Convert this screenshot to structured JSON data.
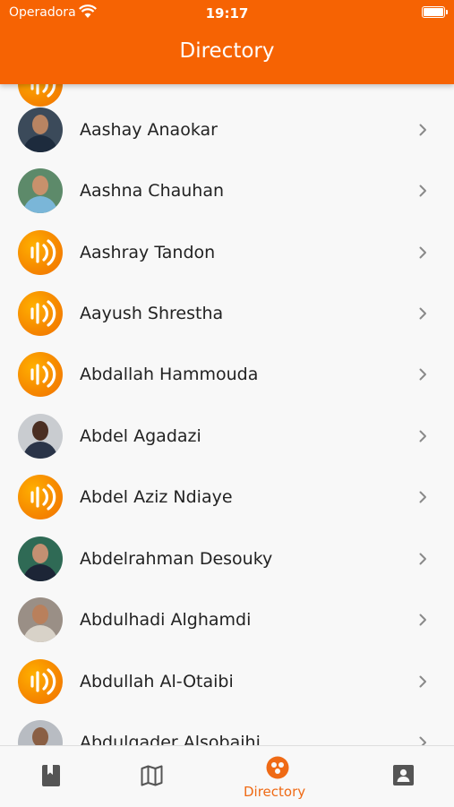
{
  "status_bar": {
    "carrier": "Operadora",
    "time": "19:17"
  },
  "header": {
    "title": "Directory"
  },
  "contacts": [
    {
      "name": "",
      "avatar": "logo-icon"
    },
    {
      "name": "Aashay Anaokar",
      "avatar": "photo"
    },
    {
      "name": "Aashna Chauhan",
      "avatar": "photo"
    },
    {
      "name": "Aashray Tandon",
      "avatar": "logo-icon"
    },
    {
      "name": "Aayush Shrestha",
      "avatar": "logo-icon"
    },
    {
      "name": "Abdallah Hammouda",
      "avatar": "logo-icon"
    },
    {
      "name": "Abdel Agadazi",
      "avatar": "photo"
    },
    {
      "name": "Abdel Aziz Ndiaye",
      "avatar": "logo-icon"
    },
    {
      "name": "Abdelrahman Desouky",
      "avatar": "photo"
    },
    {
      "name": "Abdulhadi Alghamdi",
      "avatar": "photo"
    },
    {
      "name": "Abdullah Al-Otaibi",
      "avatar": "logo-icon"
    },
    {
      "name": "Abdulqader Alsobaihi",
      "avatar": "photo"
    }
  ],
  "tabs": [
    {
      "icon": "bookmark-book-icon",
      "label": ""
    },
    {
      "icon": "map-icon",
      "label": ""
    },
    {
      "icon": "directory-icon",
      "label": "Directory",
      "active": true
    },
    {
      "icon": "profile-card-icon",
      "label": ""
    }
  ],
  "colors": {
    "accent": "#f66303",
    "active_tab": "#ef6a15",
    "text": "#222222",
    "chevron": "#8a8a8a"
  }
}
